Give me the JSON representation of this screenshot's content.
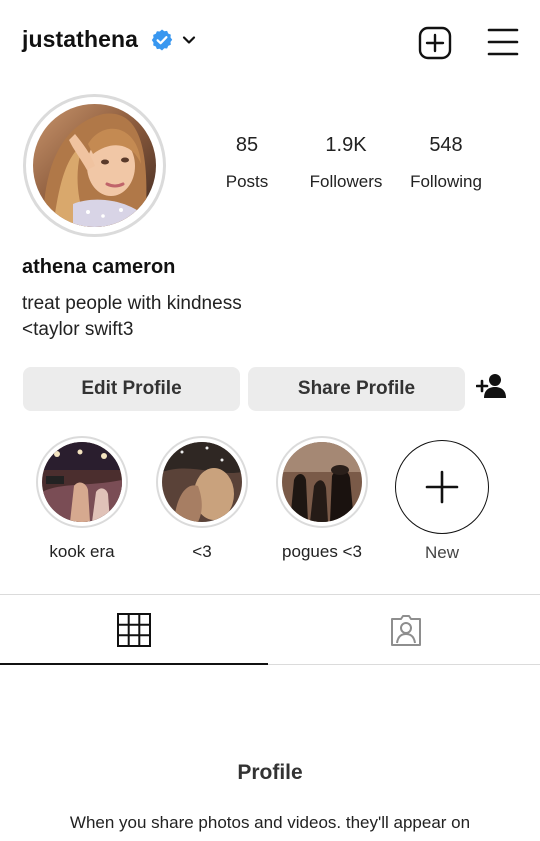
{
  "header": {
    "username": "justathena",
    "verified_icon": "verified-badge-icon",
    "dropdown_icon": "chevron-down-icon",
    "new_post_icon": "plus-square-icon",
    "menu_icon": "hamburger-menu-icon"
  },
  "profile": {
    "avatar_icon": "profile-photo",
    "display_name": "athena cameron",
    "bio_lines": [
      "treat people with kindness",
      "<taylor swift3"
    ]
  },
  "stats": [
    {
      "value": "85",
      "label": "Posts"
    },
    {
      "value": "1.9K",
      "label": "Followers"
    },
    {
      "value": "548",
      "label": "Following"
    }
  ],
  "actions": {
    "edit_label": "Edit Profile",
    "share_label": "Share Profile",
    "discover_icon": "add-person-icon"
  },
  "highlights": [
    {
      "label": "kook era"
    },
    {
      "label": "<3"
    },
    {
      "label": "pogues <3"
    },
    {
      "label": "New"
    }
  ],
  "tabs": [
    {
      "icon": "grid-icon",
      "active": true
    },
    {
      "icon": "tagged-person-icon",
      "active": false
    }
  ],
  "empty_state": {
    "title": "Profile",
    "text": "When you share photos and videos. they'll appear on"
  },
  "colors": {
    "verified": "#3897f0",
    "button_bg": "#ececec",
    "divider": "#dbdbdb"
  }
}
